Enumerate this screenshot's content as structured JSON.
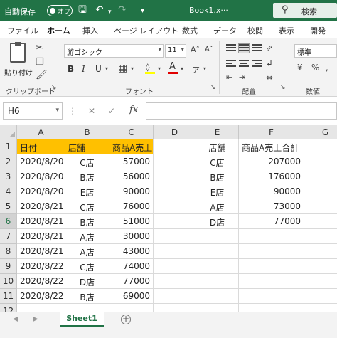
{
  "titlebar": {
    "autosave_label": "自動保存",
    "toggle_label": "オフ",
    "doc_title": "Book1.x···",
    "search_label": "検索"
  },
  "ribbon_tabs": [
    "ファイル",
    "ホーム",
    "挿入",
    "ページ レイアウト",
    "数式",
    "データ",
    "校閲",
    "表示",
    "開発"
  ],
  "ribbon": {
    "paste_label": "貼り付け",
    "clipboard_label": "クリップボード",
    "font_name": "游ゴシック",
    "font_size": "11",
    "font_label": "フォント",
    "alignment_label": "配置",
    "number_format": "標準",
    "number_label": "数値"
  },
  "formula_bar": {
    "name_box": "H6",
    "formula": ""
  },
  "columns": [
    "A",
    "B",
    "C",
    "D",
    "E",
    "F",
    "G"
  ],
  "rows": [
    {
      "n": "1",
      "A": "日付",
      "B": "店舗",
      "C": "商品A売上",
      "D": "",
      "E": "店舗",
      "F": "商品A売上合計",
      "G": ""
    },
    {
      "n": "2",
      "A": "2020/8/20",
      "B": "C店",
      "C": "57000",
      "D": "",
      "E": "C店",
      "F": "207000",
      "G": ""
    },
    {
      "n": "3",
      "A": "2020/8/20",
      "B": "B店",
      "C": "56000",
      "D": "",
      "E": "B店",
      "F": "176000",
      "G": ""
    },
    {
      "n": "4",
      "A": "2020/8/20",
      "B": "E店",
      "C": "90000",
      "D": "",
      "E": "E店",
      "F": "90000",
      "G": ""
    },
    {
      "n": "5",
      "A": "2020/8/21",
      "B": "C店",
      "C": "76000",
      "D": "",
      "E": "A店",
      "F": "73000",
      "G": ""
    },
    {
      "n": "6",
      "A": "2020/8/21",
      "B": "B店",
      "C": "51000",
      "D": "",
      "E": "D店",
      "F": "77000",
      "G": ""
    },
    {
      "n": "7",
      "A": "2020/8/21",
      "B": "A店",
      "C": "30000",
      "D": "",
      "E": "",
      "F": "",
      "G": ""
    },
    {
      "n": "8",
      "A": "2020/8/21",
      "B": "A店",
      "C": "43000",
      "D": "",
      "E": "",
      "F": "",
      "G": ""
    },
    {
      "n": "9",
      "A": "2020/8/22",
      "B": "C店",
      "C": "74000",
      "D": "",
      "E": "",
      "F": "",
      "G": ""
    },
    {
      "n": "10",
      "A": "2020/8/22",
      "B": "D店",
      "C": "77000",
      "D": "",
      "E": "",
      "F": "",
      "G": ""
    },
    {
      "n": "11",
      "A": "2020/8/22",
      "B": "B店",
      "C": "69000",
      "D": "",
      "E": "",
      "F": "",
      "G": ""
    },
    {
      "n": "12",
      "A": "",
      "B": "",
      "C": "",
      "D": "",
      "E": "",
      "F": "",
      "G": ""
    }
  ],
  "sheet_tabs": [
    "Sheet1"
  ],
  "colors": {
    "brand": "#217346",
    "header_highlight": "#ffc000"
  }
}
